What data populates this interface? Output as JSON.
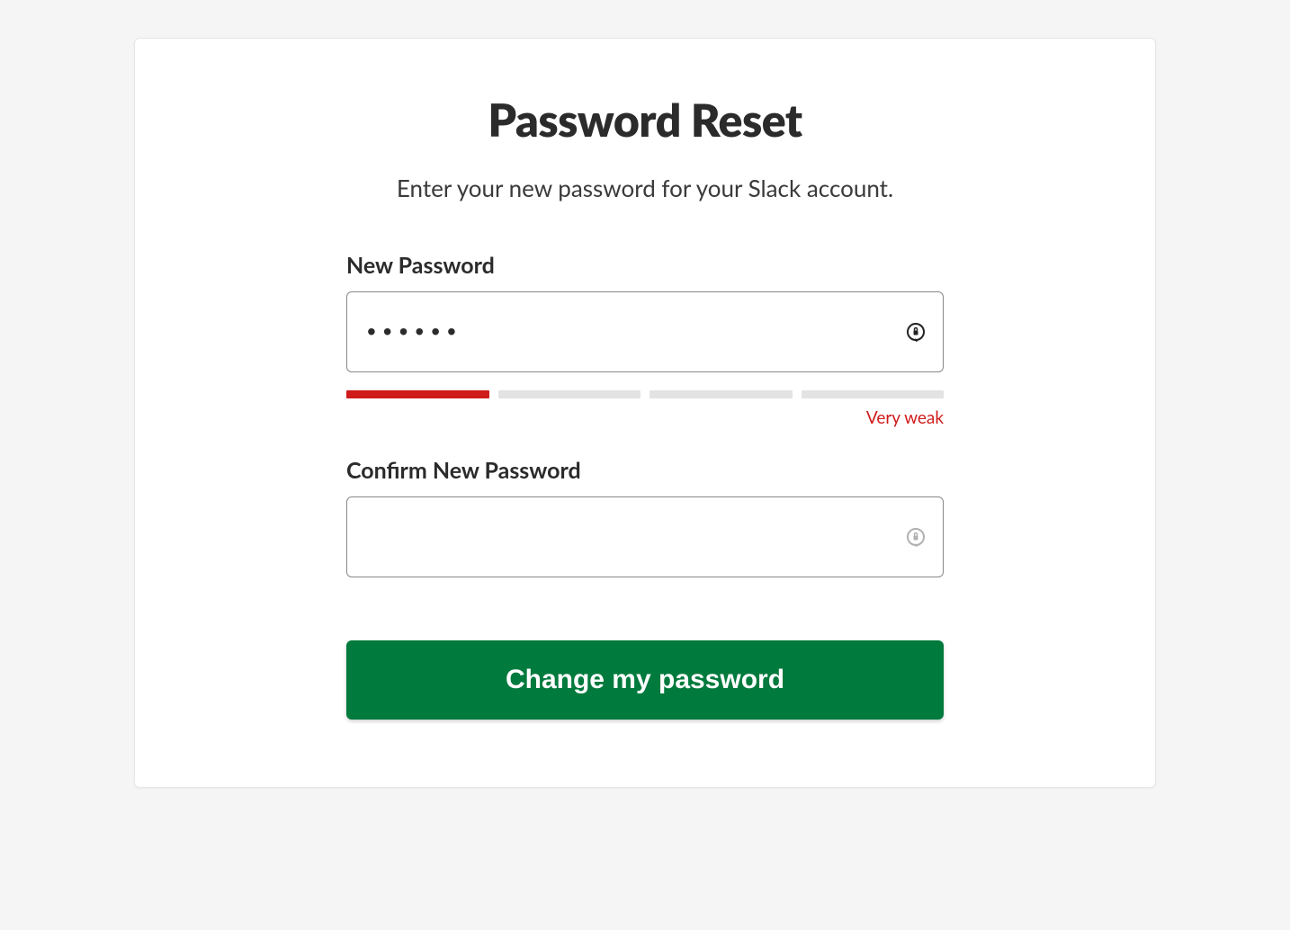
{
  "title": "Password Reset",
  "subtitle": "Enter your new password for your Slack account.",
  "form": {
    "new_password_label": "New Password",
    "new_password_value": "••••••",
    "confirm_password_label": "Confirm New Password",
    "confirm_password_value": "",
    "submit_label": "Change my password"
  },
  "strength": {
    "text": "Very weak",
    "level": 1,
    "bars": 4,
    "active_color": "#d01b1b"
  }
}
